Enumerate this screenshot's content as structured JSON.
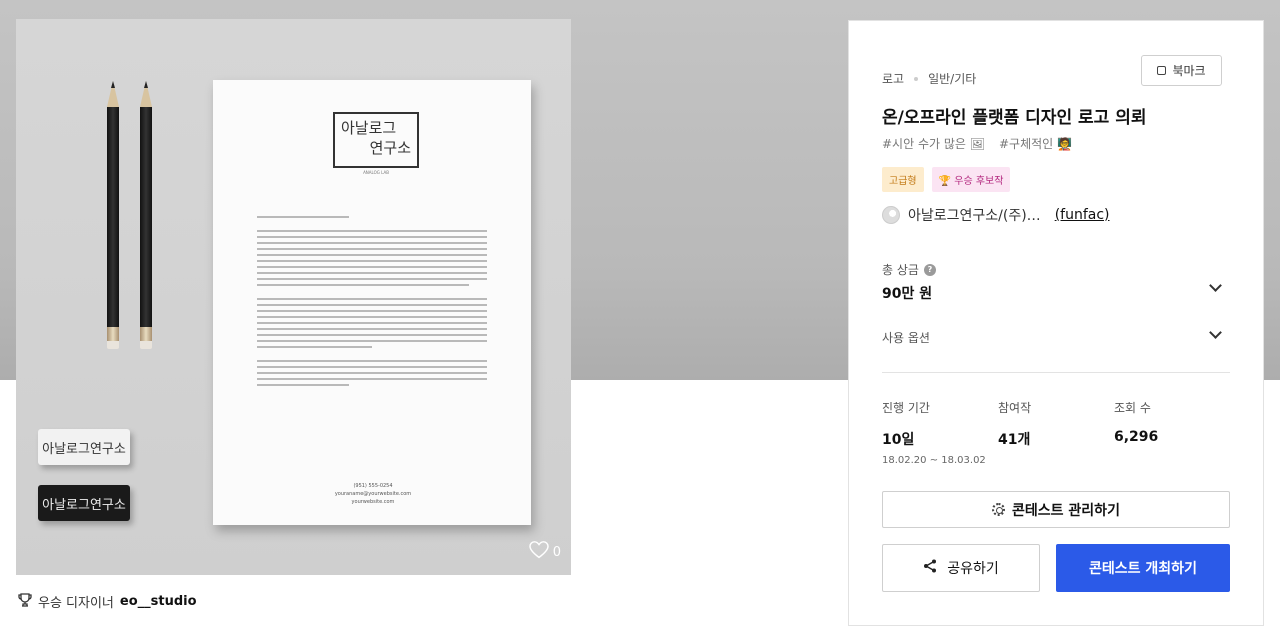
{
  "gallery": {
    "likes_count": "0",
    "paper": {
      "logo_line1": "아날로그",
      "logo_line2": "연구소",
      "logo_subtitle": "ANALOG LAB",
      "footer_line1": "(951) 555-0254",
      "footer_line2": "youraname@yourwebsite.com",
      "footer_line3": "yourwebsite.com"
    },
    "eraser_text": "아날로그연구소"
  },
  "credit": {
    "prefix": "우승 디자이너",
    "designer": "eo__studio"
  },
  "contest": {
    "breadcrumb": [
      "로고",
      "일반/기타"
    ],
    "bookmark_label": "북마크",
    "title": "온/오프라인 플랫폼 디자인 로고 의뢰",
    "tags": [
      "#시안 수가 많은 🖼",
      "#구체적인 🧑‍🏫"
    ],
    "badges": {
      "premium": "고급형",
      "winner": "🏆 우승 후보작"
    },
    "host": {
      "name": "아날로그연구소/(주)…",
      "username": "(funfac)"
    },
    "total_prize_label": "총 상금",
    "total_prize_help": "?",
    "total_prize_value": "90만 원",
    "usage_option_label": "사용 옵션",
    "stats": {
      "period_label": "진행 기간",
      "period_value": "10일",
      "period_dates": "18.02.20 ~ 18.03.02",
      "entries_label": "참여작",
      "entries_value": "41개",
      "views_label": "조회 수",
      "views_value": "6,296"
    },
    "manage_button": "콘테스트 관리하기",
    "share_button": "공유하기",
    "open_button": "콘테스트 개최하기"
  },
  "colors": {
    "primary": "#2b5ae8",
    "premium_bg": "#fdeccd",
    "winner_bg": "#fbe4f3"
  }
}
